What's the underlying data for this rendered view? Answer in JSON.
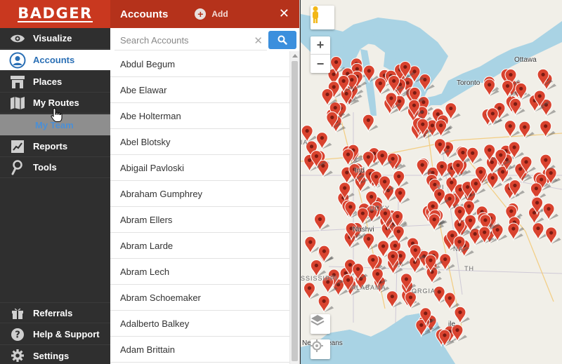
{
  "brand": {
    "name": "BADGER"
  },
  "nav": {
    "items": [
      {
        "label": "Visualize",
        "icon": "eye-icon"
      },
      {
        "label": "Accounts",
        "icon": "person-circle-icon"
      },
      {
        "label": "Places",
        "icon": "storefront-icon"
      },
      {
        "label": "My Routes",
        "icon": "map-icon"
      },
      {
        "label": "Reports",
        "icon": "chart-icon"
      },
      {
        "label": "Tools",
        "icon": "wrench-icon"
      }
    ],
    "sub_item": {
      "label": "My Team"
    },
    "bottom_items": [
      {
        "label": "Referrals",
        "icon": "gift-icon"
      },
      {
        "label": "Help & Support",
        "icon": "question-icon"
      },
      {
        "label": "Settings",
        "icon": "gear-icon"
      }
    ],
    "active": "Accounts"
  },
  "panel": {
    "title": "Accounts",
    "add_label": "Add",
    "close_label": "✕",
    "search_placeholder": "Search Accounts",
    "accounts": [
      "Abdul Begum",
      "Abe Elawar",
      "Abe Holterman",
      "Abel Blotsky",
      "Abigail Pavloski",
      "Abraham Gumphrey",
      "Abram Ellers",
      "Abram Larde",
      "Abram Lech",
      "Abram Schoemaker",
      "Adalberto Balkey",
      "Adam Brittain"
    ]
  },
  "map": {
    "zoom_in": "+",
    "zoom_out": "−",
    "labels": {
      "toronto": "Toronto",
      "ottawa": "Ottawa",
      "vi": "VI",
      "ia": "IA",
      "ind": "Ind",
      "ucky": "UCKY",
      "ssissippi": "SSISSIPPI",
      "alabama": "ALABAMA",
      "orgia": "ORGIA",
      "nashvi": "Nashvi",
      "ile": "ile",
      "new_orleans": "New Orleans",
      "th": "TH",
      "na": "NA"
    },
    "colors": {
      "water": "#a9d3e4",
      "land": "#f1efe8",
      "pin": "#d9432f"
    }
  }
}
